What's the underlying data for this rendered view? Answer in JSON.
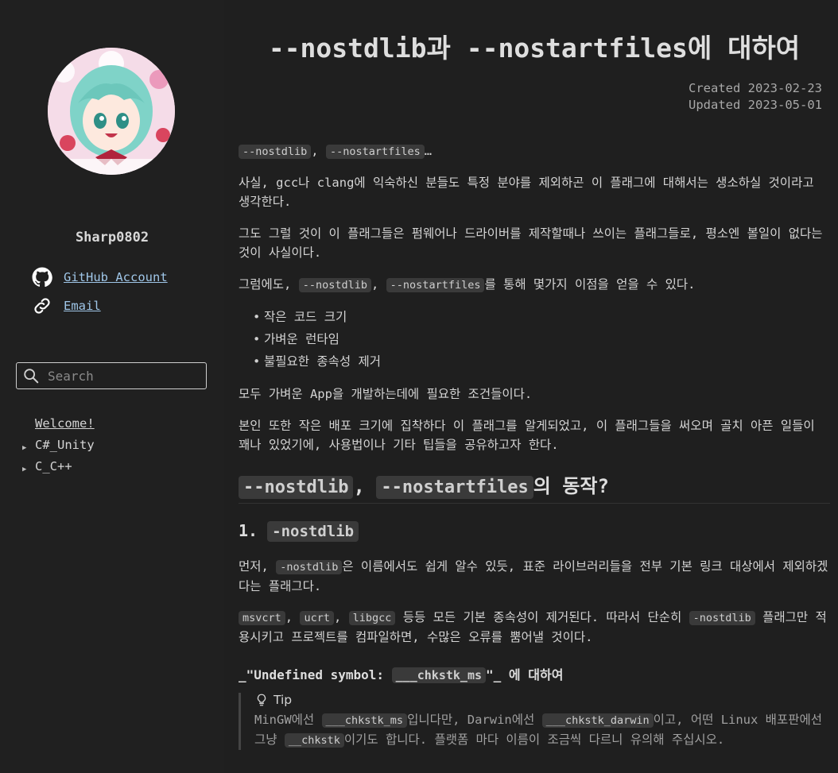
{
  "sidebar": {
    "username": "Sharp0802",
    "links": [
      {
        "label": "GitHub Account",
        "icon": "github-icon"
      },
      {
        "label": "Email",
        "icon": "link-icon"
      }
    ],
    "search": {
      "placeholder": "Search"
    },
    "nav": [
      {
        "label": "Welcome!"
      },
      {
        "label": "C#_Unity"
      },
      {
        "label": "C_C++"
      }
    ]
  },
  "article": {
    "title": "--nostdlib과 --nostartfiles에 대하여",
    "created": "Created 2023-02-23",
    "updated": "Updated 2023-05-01",
    "intro": {
      "code1": "--nostdlib",
      "sep": ", ",
      "code2": "--nostartfiles",
      "ellipsis": "…"
    },
    "p1": "사실, gcc나 clang에 익숙하신 분들도 특정 분야를 제외하곤 이 플래그에 대해서는 생소하실 것이라고 생각한다.",
    "p2": "그도 그럴 것이 이 플래그들은 펌웨어나 드라이버를 제작할때나 쓰이는 플래그들로, 평소엔 볼일이 없다는 것이 사실이다.",
    "p3": {
      "pre": "그럼에도, ",
      "code1": "--nostdlib",
      "sep": ", ",
      "code2": "--nostartfiles",
      "post": "를 통해 몇가지 이점을 얻을 수 있다."
    },
    "bullets": [
      "작은 코드 크기",
      "가벼운 런타임",
      "불필요한 종속성 제거"
    ],
    "p4": "모두 가벼운 App을 개발하는데에 필요한 조건들이다.",
    "p5": "본인 또한 작은 배포 크기에 집착하다 이 플래그를 알게되었고, 이 플래그들을 써오며 골치 아픈 일들이 꽤나 있었기에, 사용법이나 기타 팁들을 공유하고자 한다.",
    "h2": {
      "code1": "--nostdlib",
      "sep": ", ",
      "code2": "--nostartfiles",
      "post": "의 동작?"
    },
    "h3": {
      "pre": "1. ",
      "code": "-nostdlib"
    },
    "p6": {
      "pre": "먼저, ",
      "code": "-nostdlib",
      "post": "은 이름에서도 쉽게 알수 있듯, 표준 라이브러리들을 전부 기본 링크 대상에서 제외하겠다는 플래그다."
    },
    "p7": {
      "code1": "msvcrt",
      "code2": "ucrt",
      "code3": "libgcc",
      "mid": " 등등 모든 기본 종속성이 제거된다. 따라서 단순히 ",
      "code4": "-nostdlib",
      "post": " 플래그만 적용시키고 프로젝트를 컴파일하면, 수많은 오류를 뿜어낼 것이다."
    },
    "h4": {
      "pre": "_\"Undefined symbol: ",
      "code": "___chkstk_ms",
      "post": "\"_ 에 대하여"
    },
    "tip": {
      "title": "Tip",
      "t1": "MinGW에선 ",
      "c1": "___chkstk_ms",
      "t2": "입니다만, Darwin에선 ",
      "c2": "___chkstk_darwin",
      "t3": "이고, 어떤 Linux 배포판에선 그냥 ",
      "c3": "__chkstk",
      "t4": "이기도 합니다. 플랫폼 마다 이름이 조금씩 다르니 유의해 주십시오."
    }
  }
}
